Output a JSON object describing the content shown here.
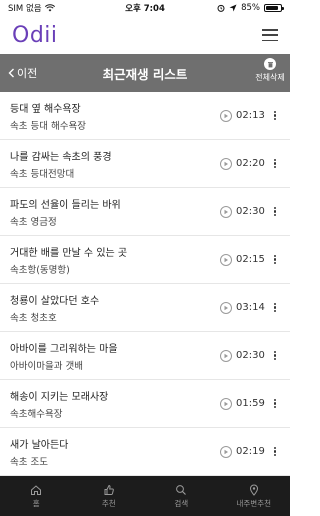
{
  "status": {
    "carrier": "SIM 없음",
    "time": "오후 7:04",
    "battery": "85%",
    "battery_level": 0.85
  },
  "app": {
    "logo": "Odii"
  },
  "subheader": {
    "back_label": "이전",
    "title": "최근재생 리스트",
    "delete_all_label": "전체삭제"
  },
  "items": [
    {
      "title": "등대 옆 해수욕장",
      "subtitle": "속초 등대 해수욕장",
      "duration": "02:13"
    },
    {
      "title": "나를 감싸는 속초의 풍경",
      "subtitle": "속초 등대전망대",
      "duration": "02:20"
    },
    {
      "title": "파도의 선율이 들리는 바위",
      "subtitle": "속초 영금정",
      "duration": "02:30"
    },
    {
      "title": "거대한 배를 만날 수 있는 곳",
      "subtitle": "속초항(동명항)",
      "duration": "02:15"
    },
    {
      "title": "청룡이 살았다던 호수",
      "subtitle": "속초 청초호",
      "duration": "03:14"
    },
    {
      "title": "아바이를 그리워하는 마을",
      "subtitle": "아바이마을과 갯배",
      "duration": "02:30"
    },
    {
      "title": "해송이 지키는 모래사장",
      "subtitle": "속초해수욕장",
      "duration": "01:59"
    },
    {
      "title": "새가 날아든다",
      "subtitle": "속초 조도",
      "duration": "02:19"
    }
  ],
  "nav": [
    {
      "label": "홈",
      "icon": "home-icon"
    },
    {
      "label": "추천",
      "icon": "thumbs-up-icon"
    },
    {
      "label": "검색",
      "icon": "search-icon"
    },
    {
      "label": "내주변추천",
      "icon": "location-pin-icon"
    }
  ],
  "colors": {
    "brand": "#6a3fb8",
    "subheader_bg": "#6f6f6f",
    "nav_bg": "#1c1c1c"
  }
}
